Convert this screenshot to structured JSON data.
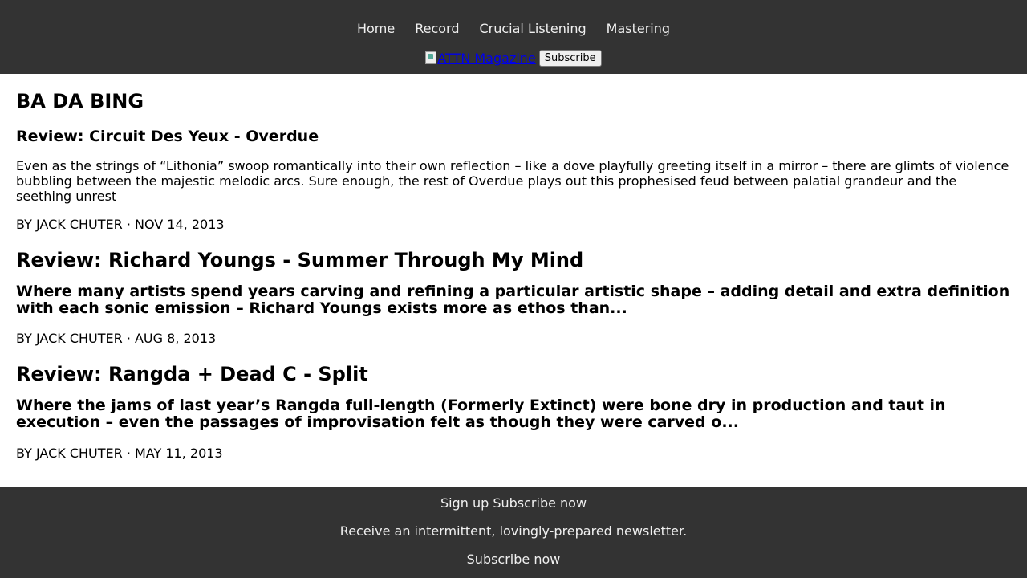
{
  "nav": {
    "items": [
      "Home",
      "Record",
      "Crucial Listening",
      "Mastering"
    ]
  },
  "brand": {
    "logo_alt": "ATTN Magazine",
    "subscribe_button": "Subscribe"
  },
  "site_title": "BA DA BING",
  "posts": [
    {
      "title": "Review: Circuit Des Yeux - Overdue",
      "excerpt": "Even as the strings of “Lithonia” swoop romantically into their own reflection – like a dove playfully greeting itself in a mirror – there are glimts of violence bubbling between the majestic melodic arcs. Sure enough, the rest of Overdue plays out this prophesised feud between palatial grandeur and the seething unrest",
      "meta": "BY JACK CHUTER · NOV 14, 2013"
    },
    {
      "title": "Review: Richard Youngs - Summer Through My Mind",
      "excerpt": "Where many artists spend years carving and refining a particular artistic shape – adding detail and extra definition with each sonic emission – Richard Youngs exists more as ethos than...",
      "meta": "BY JACK CHUTER · AUG 8, 2013"
    },
    {
      "title": "Review: Rangda + Dead C - Split",
      "excerpt": "Where the jams of last year’s Rangda full-length (Formerly Extinct) were bone dry in production and taut in execution – even the passages of improvisation felt as though they were carved o...",
      "meta": "BY JACK CHUTER · MAY 11, 2013"
    }
  ],
  "footer": {
    "signup_label": "Sign up",
    "subscribe_now_inline": "Subscribe now",
    "tagline": "Receive an intermittent, lovingly-prepared newsletter.",
    "subscribe_now": "Subscribe now"
  },
  "colors": {
    "header_bg": "#333333",
    "footer_bg": "#333333",
    "link_default": "#0000ee"
  }
}
